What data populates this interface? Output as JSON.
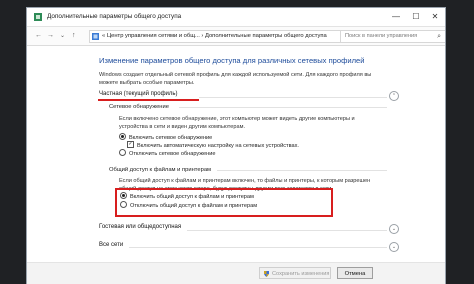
{
  "window": {
    "title": "Дополнительные параметры общего доступа",
    "minimize_symbol": "—",
    "maximize_symbol": "☐",
    "close_symbol": "✕"
  },
  "nav": {
    "back": "←",
    "forward": "→",
    "up": "↑",
    "address": "«  Центр управления сетями и общ...  ›  Дополнительные параметры общего доступа",
    "search_placeholder": "Поиск в панели управления"
  },
  "page": {
    "title": "Изменение параметров общего доступа для различных сетевых профилей",
    "description": "Windows создает отдельный сетевой профиль для каждой используемой сети. Для каждого профиля вы можете выбрать особые параметры."
  },
  "private_profile": {
    "header": "Частная (текущий профиль)",
    "chevron": "⌃",
    "network_discovery": {
      "title": "Сетевое обнаружение",
      "text": "Если включено сетевое обнаружение, этот компьютер может видеть другие компьютеры и устройства в сети и виден другим компьютерам.",
      "enable_label": "Включить сетевое обнаружение",
      "auto_setup_label": "Включить автоматическую настройку на сетевых устройствах.",
      "disable_label": "Отключить сетевое обнаружение"
    },
    "file_sharing": {
      "title": "Общий доступ к файлам и принтерам",
      "text": "Если общий доступ к файлам и принтерам включен, то файлы и принтеры, к которым разрешен общий доступ на этом компьютере, будут доступны другим пользователям в сети.",
      "enable_label": "Включить общий доступ к файлам и принтерам",
      "disable_label": "Отключить общий доступ к файлам и принтерам"
    }
  },
  "guest_profile": {
    "header": "Гостевая или общедоступная",
    "chevron": "⌄"
  },
  "all_networks": {
    "header": "Все сети",
    "chevron": "⌄"
  },
  "footer": {
    "save_label": "Сохранить изменения",
    "cancel_label": "Отмена"
  },
  "colors": {
    "accent": "#1e4c9b",
    "highlight": "#d81e1e"
  }
}
